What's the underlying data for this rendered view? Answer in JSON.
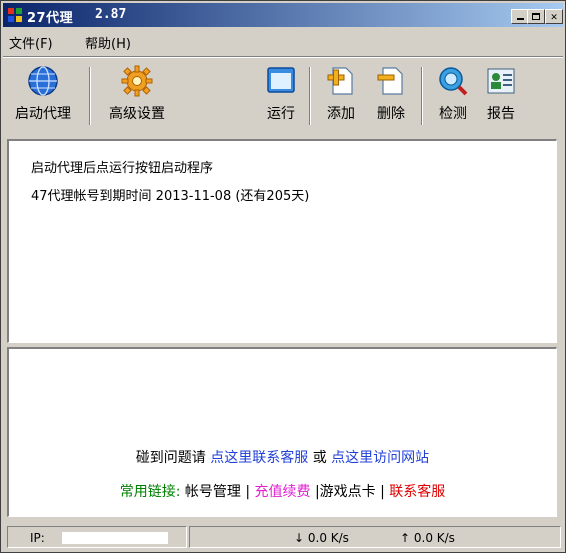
{
  "window": {
    "title": "27代理",
    "version": "2.87"
  },
  "menu": [
    {
      "label": "文件(F)"
    },
    {
      "label": "帮助(H)"
    }
  ],
  "toolbar": {
    "start": "启动代理",
    "advanced": "高级设置",
    "run": "运行",
    "add": "添加",
    "delete": "删除",
    "detect": "检测",
    "report": "报告"
  },
  "log": [
    "启动代理后点运行按钮启动程序",
    "47代理帐号到期时间 2013-11-08 (还有205天)"
  ],
  "help": {
    "prefix": "碰到问题请 ",
    "contact_link": "点这里联系客服",
    "or": " 或 ",
    "site_link": "点这里访问网站"
  },
  "links": {
    "label": "常用链接:",
    "account": "帐号管理",
    "recharge": "充值续费",
    "game_card": "游戏点卡",
    "support": "联系客服",
    "separator": "|"
  },
  "status": {
    "ip_label": "IP:",
    "down": "↓ 0.0 K/s",
    "up": "↑ 0.0 K/s"
  },
  "colors": {
    "link_blue": "#2040d8",
    "green": "#008000",
    "magenta": "#e020d0",
    "red": "#e00000"
  }
}
